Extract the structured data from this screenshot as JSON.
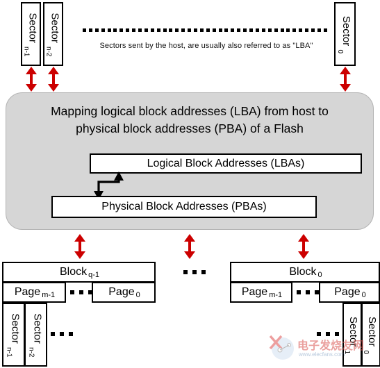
{
  "diagram": {
    "title": "Mapping logical block addresses (LBA) from host to physical block addresses (PBA) of a Flash",
    "title_line1": "Mapping logical block addresses (LBA) from host to",
    "title_line2": "physical block addresses (PBA) of a Flash",
    "caption": "Sectors sent by the host, are usually  also referred to as \"LBA\"",
    "accent_color": "#cc0000",
    "panel_color": "#d6d6d6"
  },
  "host_sectors": [
    {
      "label": "Sector",
      "subscript": "n-1"
    },
    {
      "label": "Sector",
      "subscript": "n-2"
    },
    {
      "label": "Sector",
      "subscript": "0"
    }
  ],
  "mapping": {
    "lba_box": "Logical Block Addresses (LBAs)",
    "pba_box": "Physical Block Addresses (PBAs)"
  },
  "blocks": [
    {
      "name": "Block",
      "subscript": "q-1",
      "pages": [
        {
          "label": "Page",
          "subscript": "m-1"
        },
        {
          "label": "Page",
          "subscript": "0"
        }
      ],
      "sectors": [
        {
          "label": "Sector",
          "subscript": "n-1"
        },
        {
          "label": "Sector",
          "subscript": "n-2"
        }
      ]
    },
    {
      "name": "Block",
      "subscript": "0",
      "pages": [
        {
          "label": "Page",
          "subscript": "m-1"
        },
        {
          "label": "Page",
          "subscript": "0"
        }
      ],
      "sectors": [
        {
          "label": "Sector",
          "subscript": "1"
        },
        {
          "label": "Sector",
          "subscript": "0"
        }
      ]
    }
  ],
  "watermark": {
    "text": "电子发烧友网",
    "url": "www.elecfans.com"
  }
}
